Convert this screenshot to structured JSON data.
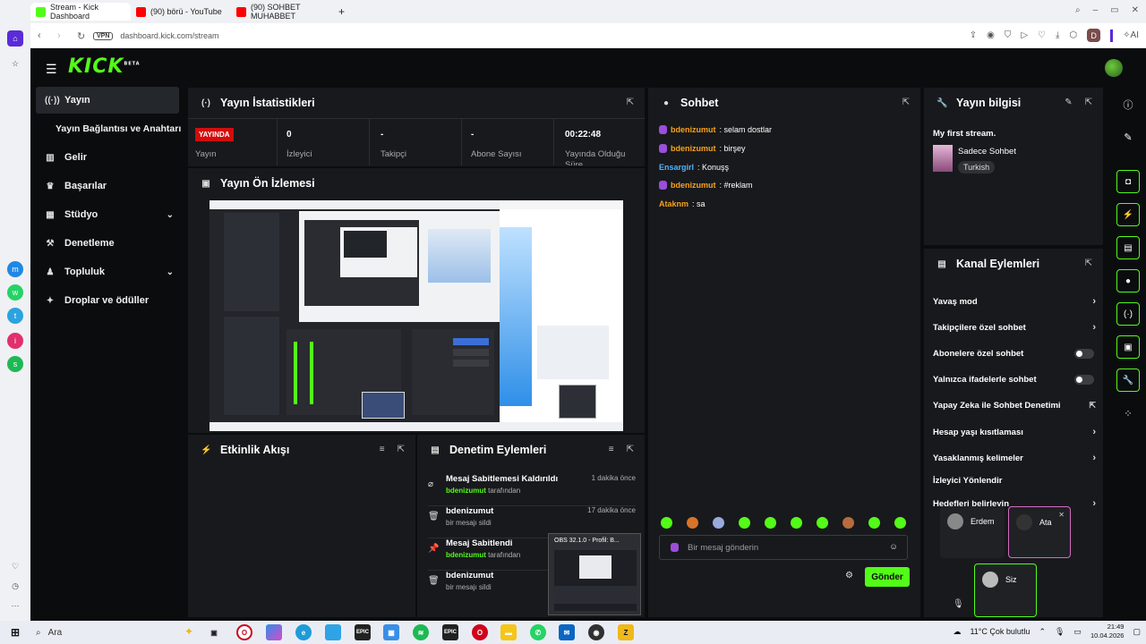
{
  "browser": {
    "tabs": [
      {
        "label": "Stream - Kick Dashboard",
        "favicon_color": "#53fc18",
        "active": true
      },
      {
        "label": "(90) börü - YouTube",
        "favicon_color": "#ff0000",
        "active": false
      },
      {
        "label": "(90) SOHBET MUHABBET",
        "favicon_color": "#ff0000",
        "active": false
      }
    ],
    "new_tab": "+",
    "vpn": "VPN",
    "url": "dashboard.kick.com/stream",
    "profile_initial": "D",
    "ai_label": "AI"
  },
  "kick": {
    "logo": "KICK",
    "logo_sup": "BETA"
  },
  "nav": [
    {
      "label": "Yayın",
      "icon": "broadcast-icon",
      "active": true
    },
    {
      "label": "Yayın Bağlantısı ve Anahtarı",
      "icon": "key-icon",
      "active": false
    },
    {
      "label": "Gelir",
      "icon": "chart-icon",
      "active": false
    },
    {
      "label": "Başarılar",
      "icon": "trophy-icon",
      "active": false
    },
    {
      "label": "Stüdyo",
      "icon": "studio-icon",
      "active": false,
      "expand": true
    },
    {
      "label": "Denetleme",
      "icon": "gavel-icon",
      "active": false
    },
    {
      "label": "Topluluk",
      "icon": "community-icon",
      "active": false,
      "expand": true
    },
    {
      "label": "Droplar ve ödüller",
      "icon": "gift-icon",
      "active": false
    }
  ],
  "stats": {
    "title": "Yayın İstatistikleri",
    "live_badge": "YAYINDA",
    "live_label": "Yayın",
    "items": [
      {
        "value": "0",
        "label": "İzleyici"
      },
      {
        "value": "-",
        "label": "Takipçi"
      },
      {
        "value": "-",
        "label": "Abone Sayısı"
      },
      {
        "value": "00:22:48",
        "label": "Yayında Olduğu Süre"
      }
    ]
  },
  "preview": {
    "title": "Yayın Ön İzlemesi"
  },
  "activity": {
    "title": "Etkinlik Akışı"
  },
  "moderation": {
    "title": "Denetim Eylemleri",
    "rows": [
      {
        "title": "Mesaj Sabitlemesi Kaldırıldı",
        "user": "bdenizumut",
        "suffix": "tarafından",
        "sub": "",
        "time": "1 dakika önce",
        "icon": "unpin-icon"
      },
      {
        "title": "bdenizumut",
        "user": "",
        "suffix": "",
        "sub": "bir mesajı sildi",
        "time": "17 dakika önce",
        "icon": "trash-icon"
      },
      {
        "title": "Mesaj Sabitlendi",
        "user": "bdenizumut",
        "suffix": "tarafından",
        "sub": "",
        "time": "",
        "icon": "pin-icon"
      },
      {
        "title": "bdenizumut",
        "user": "",
        "suffix": "",
        "sub": "bir mesajı sildi",
        "time": "",
        "icon": "trash-icon"
      }
    ]
  },
  "chat": {
    "title": "Sohbet",
    "messages": [
      {
        "user": "bdenizumut",
        "text": ": selam dostlar",
        "color": "#f7a21b",
        "badge": true
      },
      {
        "user": "bdenizumut",
        "text": ": birşey",
        "color": "#f7a21b",
        "badge": true
      },
      {
        "user": "Ensargirl",
        "text": ": Konuşş",
        "color": "#4fb3ff",
        "badge": false
      },
      {
        "user": "bdenizumut",
        "text": ": #reklam",
        "color": "#f7a21b",
        "badge": true
      },
      {
        "user": "Ataknm",
        "text": ": sa",
        "color": "#f7a21b",
        "badge": false
      }
    ],
    "input_placeholder": "Bir mesaj gönderin",
    "send_label": "Gönder"
  },
  "stream_info": {
    "title": "Yayın bilgisi",
    "stream_title": "My first stream.",
    "category": "Sadece Sohbet",
    "language": "Turkish"
  },
  "channel_actions": {
    "title": "Kanal Eylemleri",
    "items": [
      {
        "label": "Yavaş mod",
        "control": "chevron"
      },
      {
        "label": "Takipçilere özel sohbet",
        "control": "chevron"
      },
      {
        "label": "Abonelere özel sohbet",
        "control": "toggle"
      },
      {
        "label": "Yalnızca ifadelerle sohbet",
        "control": "toggle"
      },
      {
        "label": "Yapay Zeka ile Sohbet Denetimi",
        "control": "external"
      },
      {
        "label": "Hesap yaşı kısıtlaması",
        "control": "chevron"
      },
      {
        "label": "Yasaklanmış kelimeler",
        "control": "chevron"
      },
      {
        "label": "İzleyici Yönlendir",
        "control": "none"
      },
      {
        "label": "Hedefleri belirleyin",
        "control": "chevron"
      }
    ]
  },
  "call": {
    "participants": [
      "Erdem",
      "Ata",
      "Siz"
    ]
  },
  "obs_popup": {
    "title": "OBS 32.1.0 - Profil: B..."
  },
  "taskbar": {
    "search": "Ara",
    "weather": "11°C  Çok bulutlu",
    "time": "21:49",
    "date": "10.04.2026"
  },
  "colors": {
    "accent": "#53fc18",
    "live": "#d10d0d",
    "panel": "#18191c"
  }
}
